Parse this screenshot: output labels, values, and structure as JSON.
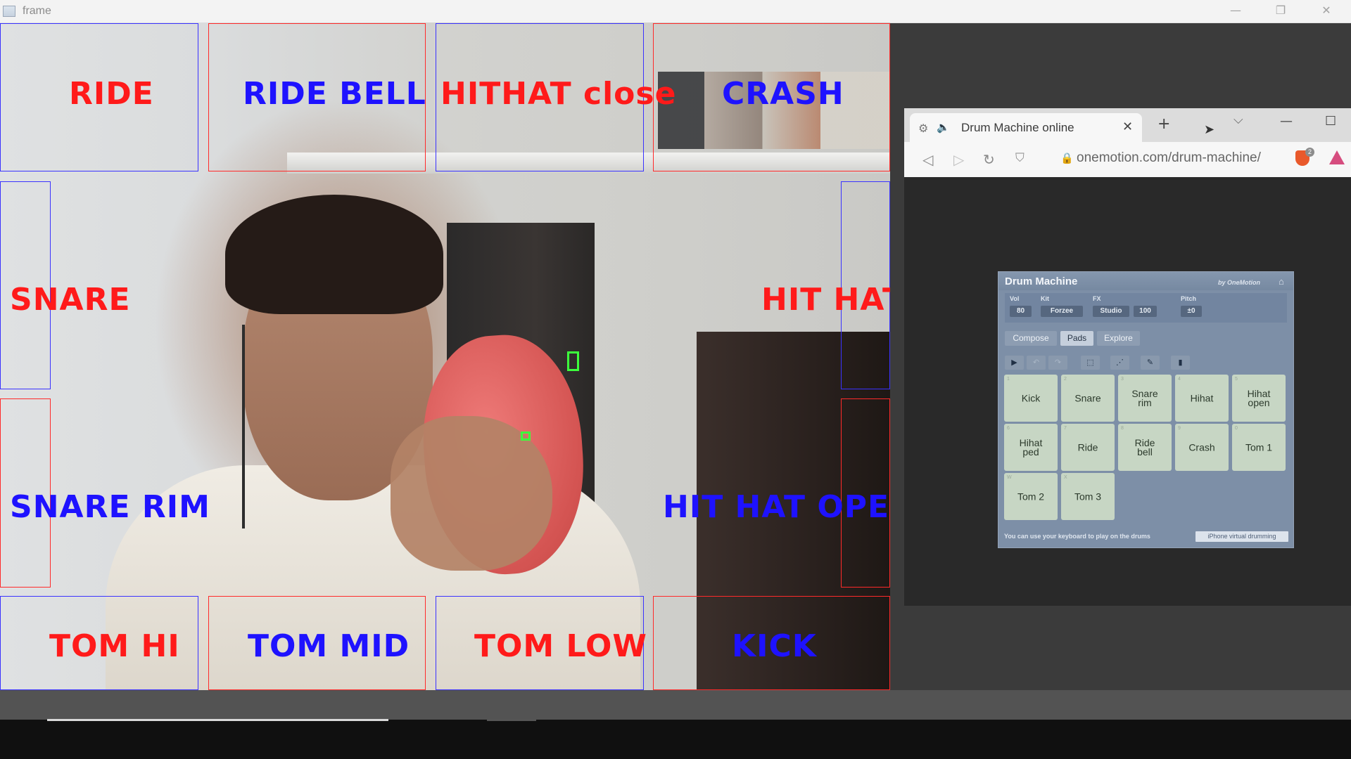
{
  "window": {
    "title": "frame",
    "controls": [
      "—",
      "❐",
      "✕"
    ]
  },
  "zones": [
    {
      "label": "RIDE",
      "color": "red"
    },
    {
      "label": "RIDE  BELL",
      "color": "blue"
    },
    {
      "label": "HITHAT  close",
      "color": "red"
    },
    {
      "label": "CRASH",
      "color": "blue"
    },
    {
      "label": "SNARE",
      "color": "red"
    },
    {
      "label": "HIT  HAT",
      "color": "red"
    },
    {
      "label": "SNARE  RIM",
      "color": "blue"
    },
    {
      "label": "HIT  HAT  OPEN",
      "color": "blue"
    },
    {
      "label": "TOM   HI",
      "color": "red"
    },
    {
      "label": "TOM  MID",
      "color": "blue"
    },
    {
      "label": "TOM  LOW",
      "color": "red"
    },
    {
      "label": "KICK",
      "color": "blue"
    }
  ],
  "browser": {
    "tab_title": "Drum Machine online",
    "tab_close": "✕",
    "new_tab": "+",
    "tab_search": "⌵",
    "minimize": "—",
    "maximize": "☐",
    "url": "onemotion.com/drum-machine/",
    "brave_badge": "2"
  },
  "drum_machine": {
    "title": "Drum Machine",
    "byline": "by OneMotion",
    "controls": [
      {
        "label": "Vol",
        "value": "80"
      },
      {
        "label": "Kit",
        "value": "Forzee"
      },
      {
        "label": "FX",
        "value": "Studio"
      },
      {
        "label": "",
        "value": "100"
      },
      {
        "label": "Pitch",
        "value": "±0"
      }
    ],
    "tabs": [
      {
        "label": "Compose",
        "active": false
      },
      {
        "label": "Pads",
        "active": true
      },
      {
        "label": "Explore",
        "active": false
      }
    ],
    "tools": [
      "play-icon",
      "undo-icon",
      "redo-icon",
      "select-icon",
      "pattern-icon",
      "wrench-icon",
      "file-icon"
    ],
    "pads": [
      {
        "label": "Kick",
        "key": "1"
      },
      {
        "label": "Snare",
        "key": "2"
      },
      {
        "label": "Snare\nrim",
        "key": "3"
      },
      {
        "label": "Hihat",
        "key": "4"
      },
      {
        "label": "Hihat\nopen",
        "key": "5"
      },
      {
        "label": "Hihat\nped",
        "key": "6"
      },
      {
        "label": "Ride",
        "key": "7"
      },
      {
        "label": "Ride\nbell",
        "key": "8"
      },
      {
        "label": "Crash",
        "key": "9"
      },
      {
        "label": "Tom 1",
        "key": "0"
      },
      {
        "label": "Tom 2",
        "key": "W"
      },
      {
        "label": "Tom 3",
        "key": "X"
      }
    ],
    "footer_note": "You can use your keyboard to play on the drums",
    "iphone_button": "iPhone virtual drumming"
  },
  "colors": {
    "zone_red": "#ff1a1a",
    "zone_blue": "#1e12ff",
    "tracker_green": "#3cff3c",
    "drum_panel": "#7d8fa7",
    "pad": "#c7d6c4"
  }
}
